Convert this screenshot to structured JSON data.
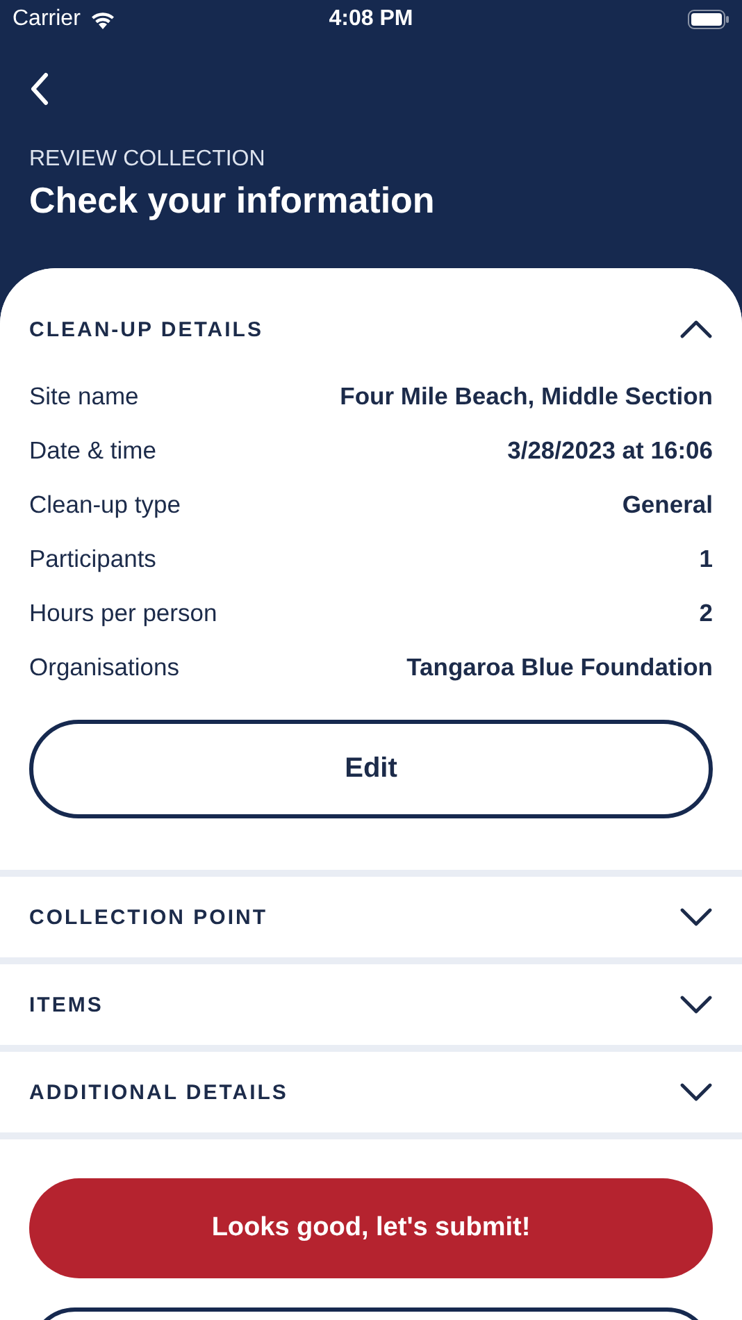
{
  "status_bar": {
    "carrier": "Carrier",
    "time": "4:08 PM"
  },
  "header": {
    "subtitle": "REVIEW COLLECTION",
    "title": "Check your information"
  },
  "sections": [
    {
      "title": "CLEAN-UP DETAILS",
      "expanded": true,
      "fields": [
        {
          "label": "Site name",
          "value": "Four Mile Beach, Middle Section"
        },
        {
          "label": "Date & time",
          "value": "3/28/2023 at 16:06"
        },
        {
          "label": "Clean-up type",
          "value": "General"
        },
        {
          "label": "Participants",
          "value": "1"
        },
        {
          "label": "Hours per person",
          "value": "2"
        },
        {
          "label": "Organisations",
          "value": "Tangaroa Blue Foundation"
        }
      ],
      "edit_button": "Edit"
    },
    {
      "title": "COLLECTION POINT",
      "expanded": false
    },
    {
      "title": "ITEMS",
      "expanded": false
    },
    {
      "title": "ADDITIONAL DETAILS",
      "expanded": false
    }
  ],
  "submit_button": "Looks good, let's submit!"
}
